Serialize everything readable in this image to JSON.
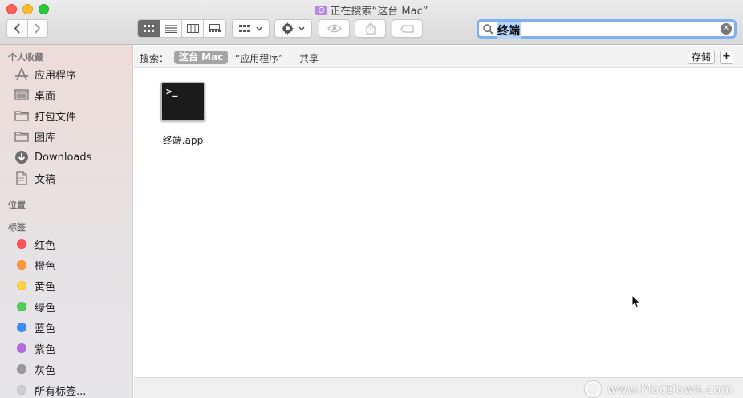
{
  "window": {
    "title": "正在搜索“这台 Mac”"
  },
  "toolbar": {
    "back": "<",
    "forward": ">",
    "search": {
      "value": "终端",
      "placeholder": ""
    }
  },
  "sidebar": {
    "sections": {
      "favorites": "个人收藏",
      "locations": "位置",
      "tags": "标签"
    },
    "favorites": [
      {
        "label": "应用程序",
        "icon": "applications-icon"
      },
      {
        "label": "桌面",
        "icon": "desktop-icon"
      },
      {
        "label": "打包文件",
        "icon": "folder-icon"
      },
      {
        "label": "图库",
        "icon": "folder-icon"
      },
      {
        "label": "Downloads",
        "icon": "downloads-icon"
      },
      {
        "label": "文稿",
        "icon": "documents-icon"
      }
    ],
    "tags": [
      {
        "label": "红色",
        "color": "#ff5257"
      },
      {
        "label": "橙色",
        "color": "#ff9a3b"
      },
      {
        "label": "黄色",
        "color": "#ffd23f"
      },
      {
        "label": "绿色",
        "color": "#4fce58"
      },
      {
        "label": "蓝色",
        "color": "#3c8ef7"
      },
      {
        "label": "紫色",
        "color": "#b56ce0"
      },
      {
        "label": "灰色",
        "color": "#9a9a9e"
      },
      {
        "label": "所有标签...",
        "color": "#cfcfd2"
      }
    ]
  },
  "scope": {
    "label": "搜索：",
    "this_mac": "这台 Mac",
    "applications": "“应用程序”",
    "shared": "共享",
    "save": "存储",
    "add": "+"
  },
  "results": [
    {
      "name": "终端.app",
      "icon": "terminal-app-icon",
      "prompt": ">_"
    }
  ],
  "watermark": "www.MacDown.com"
}
